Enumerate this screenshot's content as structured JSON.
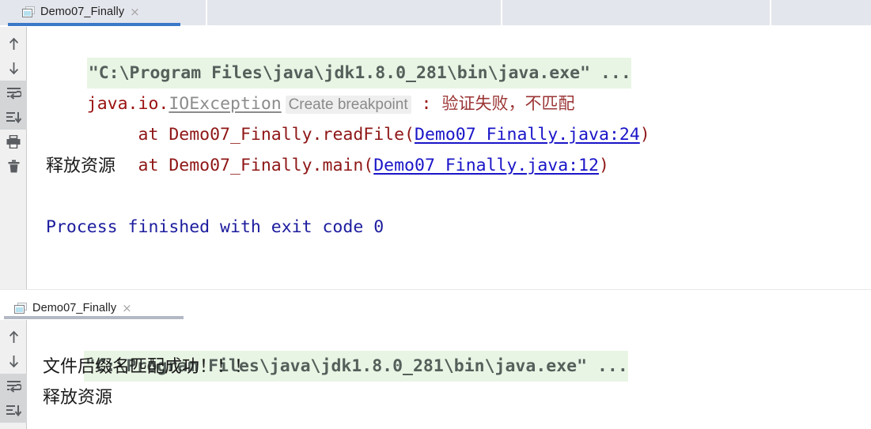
{
  "window": {
    "top_bar_segments": [
      "",
      "",
      "",
      ""
    ]
  },
  "panels": [
    {
      "tab": {
        "icon": "console-window-icon",
        "label": "Demo07_Finally",
        "close": "×",
        "active": true,
        "underline_color": "#3b78c8"
      },
      "gutter_tools": [
        {
          "name": "up-arrow-icon",
          "selected": false
        },
        {
          "name": "down-arrow-icon",
          "selected": false
        },
        {
          "name": "soft-wrap-icon",
          "selected": true
        },
        {
          "name": "scroll-to-end-icon",
          "selected": true
        },
        {
          "name": "print-icon",
          "selected": false
        },
        {
          "name": "trash-icon",
          "selected": false
        }
      ],
      "lines": {
        "command": "\"C:\\Program Files\\java\\jdk1.8.0_281\\bin\\java.exe\" ...",
        "exception_package": "java.io.",
        "exception_class": "IOException",
        "inlay_hint": "Create breakpoint",
        "exception_colon": " : ",
        "exception_message": "验证失败，不匹配",
        "stack1_prefix": "     at Demo07_Finally.readFile(",
        "stack1_link": "Demo07_Finally.java:24",
        "stack1_suffix": ")",
        "stack2_prefix": "     at Demo07_Finally.main(",
        "stack2_link": "Demo07_Finally.java:12",
        "stack2_suffix": ")",
        "release": "释放资源",
        "blank": "",
        "finished": "Process finished with exit code 0"
      }
    },
    {
      "tab": {
        "icon": "console-window-icon",
        "label": "Demo07_Finally",
        "close": "×",
        "active": false,
        "underline_color": "#b3b9c4"
      },
      "gutter_tools": [
        {
          "name": "up-arrow-icon",
          "selected": false
        },
        {
          "name": "down-arrow-icon",
          "selected": false
        },
        {
          "name": "soft-wrap-icon",
          "selected": true
        },
        {
          "name": "scroll-to-end-icon",
          "selected": true
        }
      ],
      "lines": {
        "command": "\"C:\\Program Files\\java\\jdk1.8.0_281\\bin\\java.exe\" ...",
        "success": "文件后缀名匹配成功！！！",
        "release": "释放资源"
      }
    }
  ],
  "colors": {
    "topbar_bg": "#e3e6ec",
    "gutter_bg": "#f0f0f0",
    "cmd_highlight_bg": "#e9f5e4",
    "cmd_text": "#555f5b",
    "error_red": "#9b1111",
    "link_blue": "#1a15c8",
    "output_blue": "#1c1c9e",
    "inlay_gray": "#8a8a8a",
    "tab_active_underline": "#3b78c8"
  }
}
